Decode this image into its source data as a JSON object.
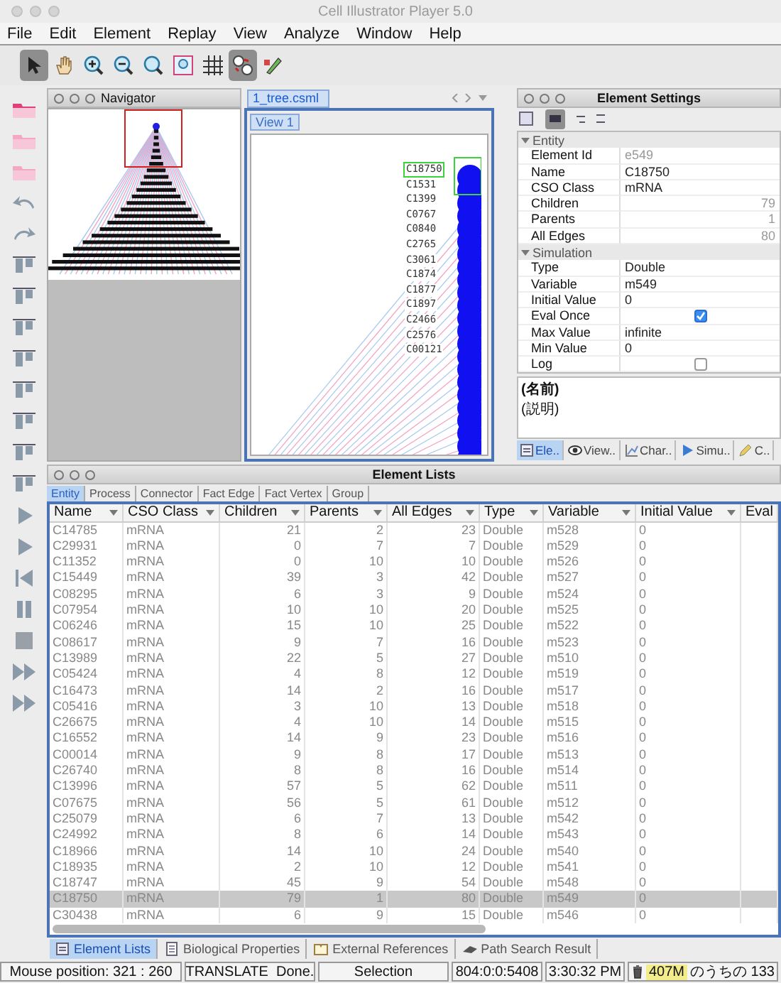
{
  "window": {
    "title": "Cell Illustrator Player 5.0"
  },
  "menu": [
    "File",
    "Edit",
    "Element",
    "Replay",
    "View",
    "Analyze",
    "Window",
    "Help"
  ],
  "toolbar": [
    {
      "kind": "select",
      "selected": true
    },
    {
      "kind": "hand",
      "selected": false
    },
    {
      "kind": "zoom-in",
      "selected": false
    },
    {
      "kind": "zoom-out",
      "selected": false
    },
    {
      "kind": "zoom",
      "selected": false
    },
    {
      "kind": "fit",
      "selected": false
    },
    {
      "kind": "grid",
      "selected": false
    },
    {
      "kind": "layout",
      "selected": true
    },
    {
      "kind": "edit",
      "selected": false
    }
  ],
  "navigator": {
    "title": "Navigator"
  },
  "document": {
    "tab": "1_tree.csml",
    "view_tab": "View 1",
    "labels": [
      {
        "text": "C18750",
        "selected": true
      },
      {
        "text": "C1531",
        "selected": false
      },
      {
        "text": "C1399",
        "selected": false
      },
      {
        "text": "C0767",
        "selected": false
      },
      {
        "text": "C0840",
        "selected": false
      },
      {
        "text": "C2765",
        "selected": false
      },
      {
        "text": "C3061",
        "selected": false
      },
      {
        "text": "C1874",
        "selected": false
      },
      {
        "text": "C1877",
        "selected": false
      },
      {
        "text": "C1897",
        "selected": false
      },
      {
        "text": "C2466",
        "selected": false
      },
      {
        "text": "C2576",
        "selected": false
      },
      {
        "text": "C00121",
        "selected": false
      }
    ]
  },
  "element_settings": {
    "title": "Element Settings",
    "sections": [
      {
        "title": "Entity",
        "expanded": true,
        "rows": [
          {
            "label": "Element Id",
            "kind": "text",
            "value": "e549",
            "disabled": true
          },
          {
            "label": "Name",
            "kind": "text",
            "value": "C18750",
            "disabled": false
          },
          {
            "label": "CSO Class",
            "kind": "text",
            "value": "mRNA",
            "disabled": false
          },
          {
            "label": "Children",
            "kind": "number",
            "value": "79",
            "disabled": true
          },
          {
            "label": "Parents",
            "kind": "number",
            "value": "1",
            "disabled": true
          },
          {
            "label": "All Edges",
            "kind": "number",
            "value": "80",
            "disabled": true
          }
        ]
      },
      {
        "title": "Simulation",
        "expanded": true,
        "rows": [
          {
            "label": "Type",
            "kind": "text",
            "value": "Double",
            "disabled": false
          },
          {
            "label": "Variable",
            "kind": "text",
            "value": "m549",
            "disabled": false
          },
          {
            "label": "Initial Value",
            "kind": "text",
            "value": "0",
            "disabled": false
          },
          {
            "label": "Eval Once",
            "kind": "checkbox",
            "checked": true
          },
          {
            "label": "Max Value",
            "kind": "text",
            "value": "infinite",
            "disabled": false
          },
          {
            "label": "Min Value",
            "kind": "text",
            "value": "0",
            "disabled": false
          },
          {
            "label": "Log",
            "kind": "checkbox",
            "checked": false
          }
        ]
      }
    ]
  },
  "description": {
    "name": "(名前)",
    "text": "(説明)"
  },
  "side_tabs": [
    {
      "label": "Ele..",
      "kind": "element",
      "selected": true
    },
    {
      "label": "View..",
      "kind": "view",
      "selected": false
    },
    {
      "label": "Char..",
      "kind": "chart",
      "selected": false
    },
    {
      "label": "Simu..",
      "kind": "simulation",
      "selected": false
    },
    {
      "label": "C..",
      "kind": "note",
      "selected": false
    }
  ],
  "element_lists": {
    "title": "Element Lists",
    "tabs": [
      {
        "label": "Entity",
        "selected": true
      },
      {
        "label": "Process",
        "selected": false
      },
      {
        "label": "Connector",
        "selected": false
      },
      {
        "label": "Fact Edge",
        "selected": false
      },
      {
        "label": "Fact Vertex",
        "selected": false
      },
      {
        "label": "Group",
        "selected": false
      }
    ],
    "columns": [
      {
        "label": "Name",
        "kind": "text",
        "menu": true
      },
      {
        "label": "CSO Class",
        "kind": "text",
        "menu": true
      },
      {
        "label": "Children",
        "kind": "number",
        "menu": true
      },
      {
        "label": "Parents",
        "kind": "number",
        "menu": true
      },
      {
        "label": "All Edges",
        "kind": "number",
        "menu": true
      },
      {
        "label": "Type",
        "kind": "text",
        "menu": true
      },
      {
        "label": "Variable",
        "kind": "text",
        "menu": true
      },
      {
        "label": "Initial Value",
        "kind": "text",
        "menu": true
      },
      {
        "label": "Eval",
        "kind": "text",
        "menu": false
      }
    ],
    "rows": [
      {
        "cells": [
          "C14785",
          "mRNA",
          "21",
          "2",
          "23",
          "Double",
          "m528",
          "0"
        ],
        "selected": false
      },
      {
        "cells": [
          "C29931",
          "mRNA",
          "0",
          "7",
          "7",
          "Double",
          "m529",
          "0"
        ],
        "selected": false
      },
      {
        "cells": [
          "C11352",
          "mRNA",
          "0",
          "10",
          "10",
          "Double",
          "m526",
          "0"
        ],
        "selected": false
      },
      {
        "cells": [
          "C15449",
          "mRNA",
          "39",
          "3",
          "42",
          "Double",
          "m527",
          "0"
        ],
        "selected": false
      },
      {
        "cells": [
          "C08295",
          "mRNA",
          "6",
          "3",
          "9",
          "Double",
          "m524",
          "0"
        ],
        "selected": false
      },
      {
        "cells": [
          "C07954",
          "mRNA",
          "10",
          "10",
          "20",
          "Double",
          "m525",
          "0"
        ],
        "selected": false
      },
      {
        "cells": [
          "C06246",
          "mRNA",
          "15",
          "10",
          "25",
          "Double",
          "m522",
          "0"
        ],
        "selected": false
      },
      {
        "cells": [
          "C08617",
          "mRNA",
          "9",
          "7",
          "16",
          "Double",
          "m523",
          "0"
        ],
        "selected": false
      },
      {
        "cells": [
          "C13989",
          "mRNA",
          "22",
          "5",
          "27",
          "Double",
          "m510",
          "0"
        ],
        "selected": false
      },
      {
        "cells": [
          "C05424",
          "mRNA",
          "4",
          "8",
          "12",
          "Double",
          "m519",
          "0"
        ],
        "selected": false
      },
      {
        "cells": [
          "C16473",
          "mRNA",
          "14",
          "2",
          "16",
          "Double",
          "m517",
          "0"
        ],
        "selected": false
      },
      {
        "cells": [
          "C05416",
          "mRNA",
          "3",
          "10",
          "13",
          "Double",
          "m518",
          "0"
        ],
        "selected": false
      },
      {
        "cells": [
          "C26675",
          "mRNA",
          "4",
          "10",
          "14",
          "Double",
          "m515",
          "0"
        ],
        "selected": false
      },
      {
        "cells": [
          "C16552",
          "mRNA",
          "14",
          "9",
          "23",
          "Double",
          "m516",
          "0"
        ],
        "selected": false
      },
      {
        "cells": [
          "C00014",
          "mRNA",
          "9",
          "8",
          "17",
          "Double",
          "m513",
          "0"
        ],
        "selected": false
      },
      {
        "cells": [
          "C26740",
          "mRNA",
          "8",
          "8",
          "16",
          "Double",
          "m514",
          "0"
        ],
        "selected": false
      },
      {
        "cells": [
          "C13996",
          "mRNA",
          "57",
          "5",
          "62",
          "Double",
          "m511",
          "0"
        ],
        "selected": false
      },
      {
        "cells": [
          "C07675",
          "mRNA",
          "56",
          "5",
          "61",
          "Double",
          "m512",
          "0"
        ],
        "selected": false
      },
      {
        "cells": [
          "C25079",
          "mRNA",
          "6",
          "7",
          "13",
          "Double",
          "m542",
          "0"
        ],
        "selected": false
      },
      {
        "cells": [
          "C24992",
          "mRNA",
          "8",
          "6",
          "14",
          "Double",
          "m543",
          "0"
        ],
        "selected": false
      },
      {
        "cells": [
          "C18966",
          "mRNA",
          "14",
          "10",
          "24",
          "Double",
          "m540",
          "0"
        ],
        "selected": false
      },
      {
        "cells": [
          "C18935",
          "mRNA",
          "2",
          "10",
          "12",
          "Double",
          "m541",
          "0"
        ],
        "selected": false
      },
      {
        "cells": [
          "C18747",
          "mRNA",
          "45",
          "9",
          "54",
          "Double",
          "m548",
          "0"
        ],
        "selected": false
      },
      {
        "cells": [
          "C18750",
          "mRNA",
          "79",
          "1",
          "80",
          "Double",
          "m549",
          "0"
        ],
        "selected": true
      },
      {
        "cells": [
          "C30438",
          "mRNA",
          "6",
          "9",
          "15",
          "Double",
          "m546",
          "0"
        ],
        "selected": false
      }
    ]
  },
  "bottom_tabs": [
    {
      "label": "Element Lists",
      "kind": "list",
      "selected": true
    },
    {
      "label": "Biological Properties",
      "kind": "document",
      "selected": false
    },
    {
      "label": "External References",
      "kind": "book",
      "selected": false
    },
    {
      "label": "Path Search Result",
      "kind": "path",
      "selected": false
    }
  ],
  "status_bar": {
    "mouse": "Mouse position: 321 : 260",
    "message": "TRANSLATE  Done.",
    "mode": "Selection",
    "counts": "804:0:0:5408",
    "time": "3:30:32 PM",
    "memory_used": "407M",
    "memory_rest": "のうちの 133"
  }
}
